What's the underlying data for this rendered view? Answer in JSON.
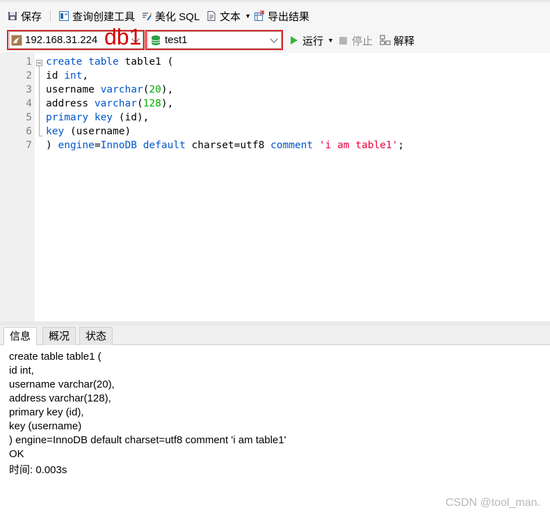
{
  "toolbar": {
    "save_label": "保存",
    "query_builder_label": "查询创建工具",
    "beautify_label": "美化 SQL",
    "text_label": "文本",
    "export_label": "导出结果"
  },
  "connection": {
    "host": "192.168.31.224",
    "annotation": "db1",
    "database": "test1",
    "run_label": "运行",
    "stop_label": "停止",
    "explain_label": "解释"
  },
  "editor": {
    "line_numbers": [
      "1",
      "2",
      "3",
      "4",
      "5",
      "6",
      "7"
    ]
  },
  "tabs": [
    {
      "label": "信息"
    },
    {
      "label": "概况"
    },
    {
      "label": "状态"
    }
  ],
  "output": {
    "lines": [
      "create table table1 (",
      "id int,",
      "username varchar(20),",
      "address varchar(128),",
      "primary key (id),",
      "key (username)",
      ") engine=InnoDB default charset=utf8 comment 'i am table1'",
      "OK",
      "时间: 0.003s"
    ]
  },
  "watermark": "CSDN @tool_man.",
  "colors": {
    "keyword": "#0055cc",
    "number": "#00aa00",
    "string": "#e8003d",
    "annotation_red": "#d62828",
    "run_green": "#3cb33c"
  }
}
